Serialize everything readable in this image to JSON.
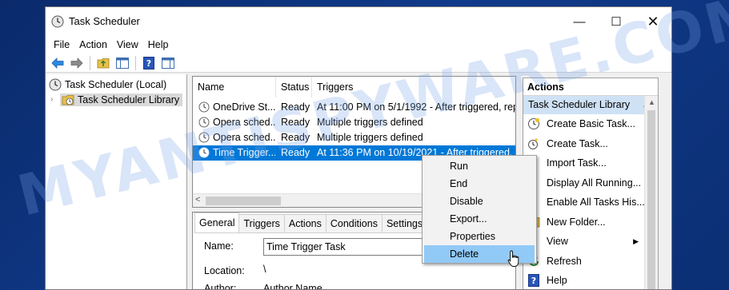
{
  "window": {
    "title": "Task Scheduler",
    "minimize": "—",
    "maximize": "☐",
    "close": "✕"
  },
  "menu": [
    "File",
    "Action",
    "View",
    "Help"
  ],
  "tree": {
    "root": "Task Scheduler (Local)",
    "library": "Task Scheduler Library"
  },
  "tasks": {
    "columns": [
      "Name",
      "Status",
      "Triggers"
    ],
    "rows": [
      {
        "name": "OneDrive St...",
        "status": "Ready",
        "triggers": "At 11:00 PM on 5/1/1992 - After triggered, repe"
      },
      {
        "name": "Opera sched...",
        "status": "Ready",
        "triggers": "Multiple triggers defined"
      },
      {
        "name": "Opera sched...",
        "status": "Ready",
        "triggers": "Multiple triggers defined"
      },
      {
        "name": "Time Trigger...",
        "status": "Ready",
        "triggers": "At 11:36 PM on 10/19/2021 - After triggered, re"
      }
    ],
    "scroll_left": "<"
  },
  "detail": {
    "tabs": [
      "General",
      "Triggers",
      "Actions",
      "Conditions",
      "Settings"
    ],
    "name_label": "Name:",
    "name_value": "Time Trigger Task",
    "location_label": "Location:",
    "location_value": "\\",
    "author_label": "Author:",
    "author_value": "Author Name"
  },
  "actions": {
    "header": "Actions",
    "group": "Task Scheduler Library",
    "items": [
      {
        "label": "Create Basic Task...",
        "icon": "create-basic-task-icon"
      },
      {
        "label": "Create Task...",
        "icon": "create-task-icon"
      },
      {
        "label": "Import Task...",
        "icon": "import-icon"
      },
      {
        "label": "Display All Running...",
        "icon": "display-running-icon"
      },
      {
        "label": "Enable All Tasks His...",
        "icon": "history-icon"
      },
      {
        "label": "New Folder...",
        "icon": "folder-icon"
      },
      {
        "label": "View",
        "icon": "none"
      },
      {
        "label": "Refresh",
        "icon": "refresh-icon"
      },
      {
        "label": "Help",
        "icon": "help-icon"
      }
    ]
  },
  "context_menu": [
    "Run",
    "End",
    "Disable",
    "Export...",
    "Properties",
    "Delete"
  ],
  "watermark": "MYANTISPYWARE.COM",
  "colors": {
    "selection": "#0078d7",
    "menu_hover": "#91c9f7",
    "actions_group": "#cfe1f5"
  }
}
